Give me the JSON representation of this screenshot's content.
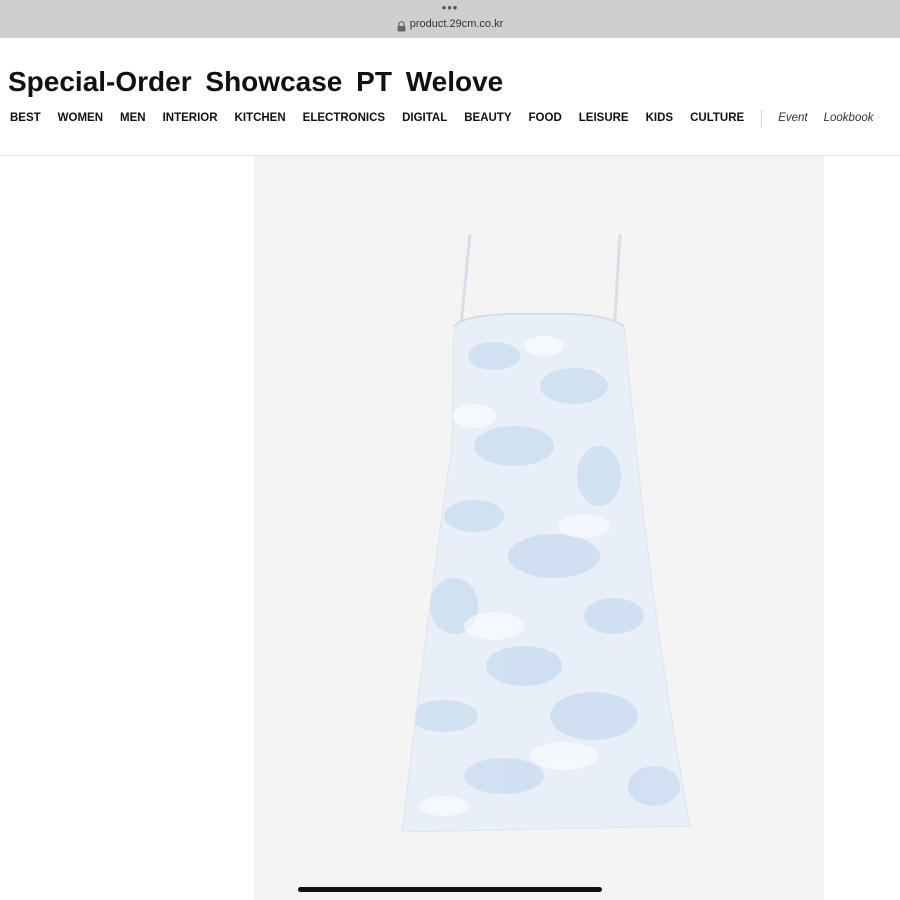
{
  "browser": {
    "dots": "•••",
    "url": "product.29cm.co.kr"
  },
  "header": {
    "title": "Special-Order  Showcase  PT  Welove"
  },
  "nav": {
    "categories": [
      "BEST",
      "WOMEN",
      "MEN",
      "INTERIOR",
      "KITCHEN",
      "ELECTRONICS",
      "DIGITAL",
      "BEAUTY",
      "FOOD",
      "LEISURE",
      "KIDS",
      "CULTURE"
    ],
    "extras": [
      "Event",
      "Lookbook"
    ]
  },
  "product": {
    "image_icon": "slip-dress-image",
    "colors": {
      "fabric": "#e8eff8",
      "print": "#c9dcf1",
      "background": "#f4f4f4"
    }
  }
}
